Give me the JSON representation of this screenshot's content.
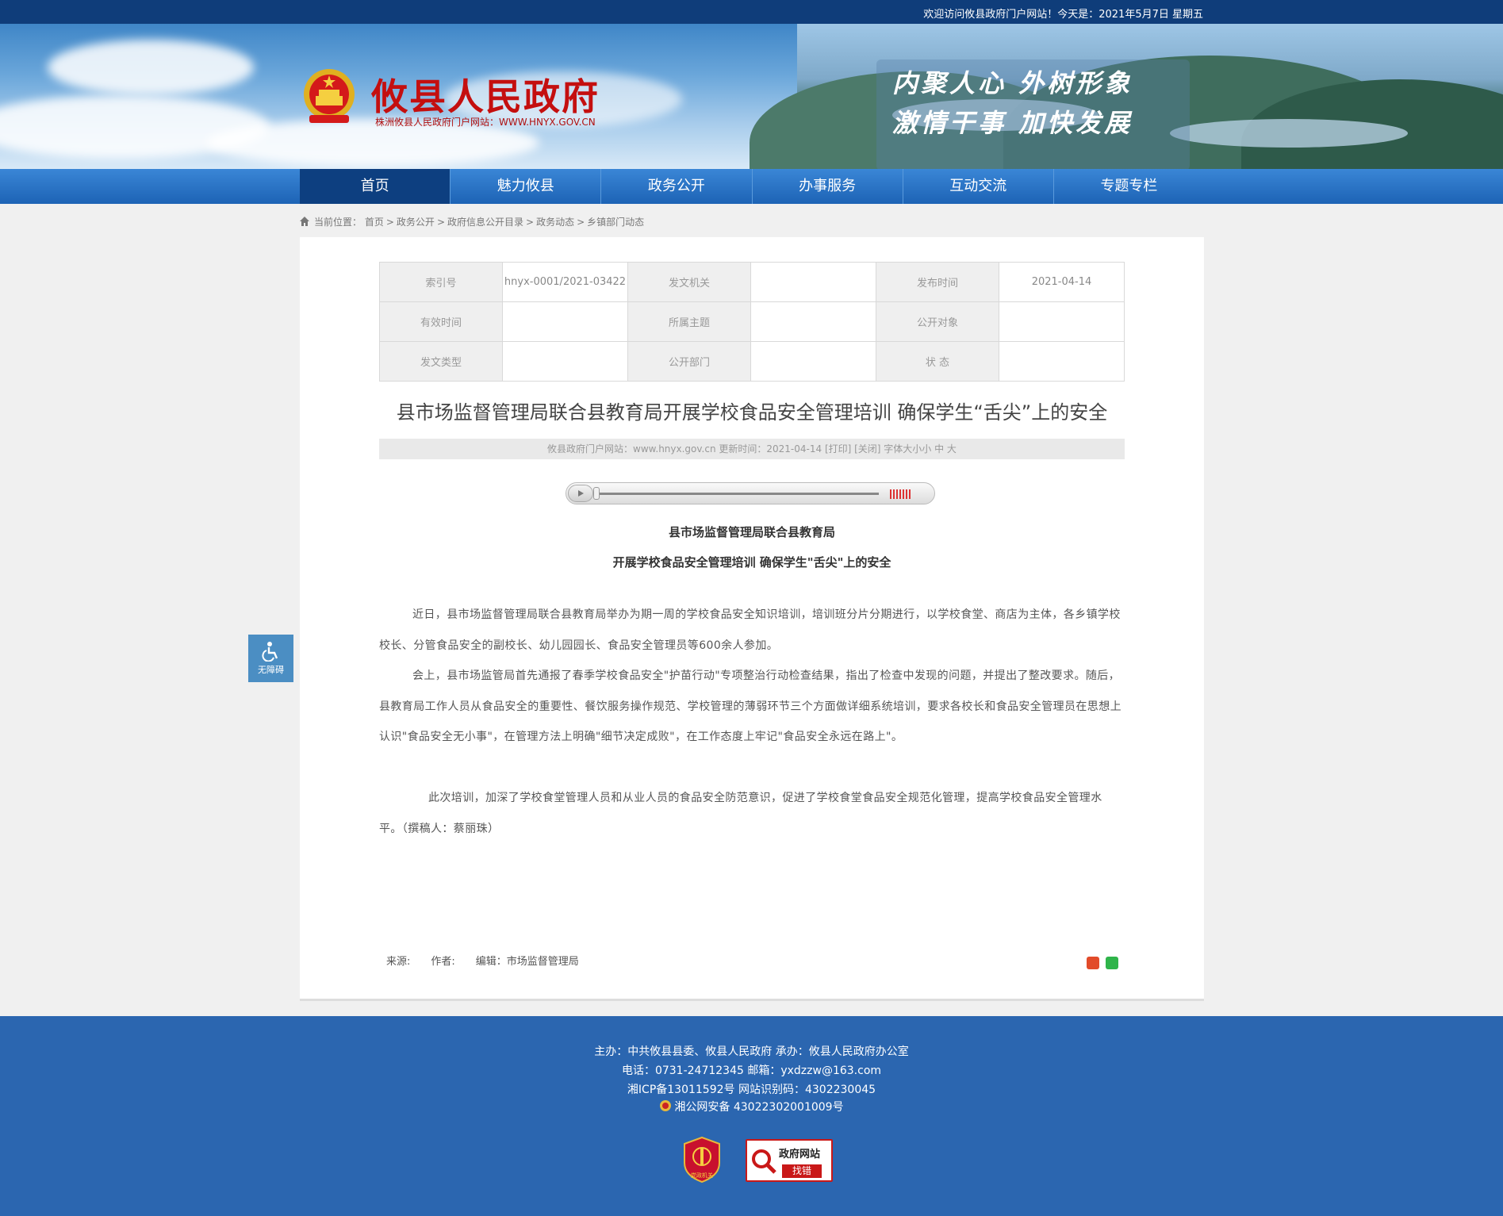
{
  "topbar": {
    "welcome": "欢迎访问攸县政府门户网站！今天是：2021年5月7日 星期五"
  },
  "header": {
    "title": "攸县人民政府",
    "subtitle": "株洲攸县人民政府门户网站：WWW.HNYX.GOV.CN",
    "slogan_line1": "内聚人心  外树形象",
    "slogan_line2": "激情干事  加快发展"
  },
  "nav": {
    "items": [
      "首页",
      "魅力攸县",
      "政务公开",
      "办事服务",
      "互动交流",
      "专题专栏"
    ],
    "active": "首页"
  },
  "breadcrumb": {
    "label": "当前位置：",
    "items": [
      "首页",
      "政务公开",
      "政府信息公开目录",
      "政务动态",
      "乡镇部门动态"
    ]
  },
  "meta": {
    "rows": [
      [
        {
          "k": "索引号",
          "v": "hnyx-0001/2021-03422"
        },
        {
          "k": "发文机关",
          "v": ""
        },
        {
          "k": "发布时间",
          "v": "2021-04-14"
        }
      ],
      [
        {
          "k": "有效时间",
          "v": ""
        },
        {
          "k": "所属主题",
          "v": ""
        },
        {
          "k": "公开对象",
          "v": ""
        }
      ],
      [
        {
          "k": "发文类型",
          "v": ""
        },
        {
          "k": "公开部门",
          "v": ""
        },
        {
          "k": "状 态",
          "v": ""
        }
      ]
    ]
  },
  "article": {
    "title": "县市场监督管理局联合县教育局开展学校食品安全管理培训 确保学生“舌尖”上的安全",
    "info": "攸县政府门户网站：www.hnyx.gov.cn    更新时间：2021-04-14  [打印]  [关闭]   字体大小小 中 大",
    "sub1": "县市场监督管理局联合县教育局",
    "sub2": "开展学校食品安全管理培训 确保学生\"舌尖\"上的安全",
    "p1": "近日，县市场监督管理局联合县教育局举办为期一周的学校食品安全知识培训，培训班分片分期进行，以学校食堂、商店为主体，各乡镇学校校长、分管食品安全的副校长、幼儿园园长、食品安全管理员等600余人参加。",
    "p2": "会上，县市场监管局首先通报了春季学校食品安全\"护苗行动\"专项整治行动检查结果，指出了检查中发现的问题，并提出了整改要求。随后，县教育局工作人员从食品安全的重要性、餐饮服务操作规范、学校管理的薄弱环节三个方面做详细系统培训，要求各校长和食品安全管理员在思想上认识\"食品安全无小事\"，在管理方法上明确\"细节决定成败\"，在工作态度上牢记\"食品安全永远在路上\"。",
    "p3": "此次培训，加深了学校食堂管理人员和从业人员的食品安全防范意识，促进了学校食堂食品安全规范化管理，提高学校食品安全管理水平。（撰稿人：蔡丽珠）",
    "source_label": "来源:",
    "author_label": "作者:",
    "editor": "编辑：市场监督管理局"
  },
  "accessibility": {
    "label": "无障碍"
  },
  "footer": {
    "line1": "主办：中共攸县县委、攸县人民政府 承办：攸县人民政府办公室",
    "line2": "电话：0731-24712345 邮箱：yxdzzw@163.com",
    "line3": "湘ICP备13011592号    网站识别码：4302230045",
    "line4": "湘公网安备 43022302001009号",
    "badge1_label": "党政机关",
    "badge2_title": "政府网站",
    "badge2_sub": "找错"
  },
  "colors": {
    "nav": "#1d63b5",
    "nav_active": "#0d3f80",
    "footer": "#2b66b0",
    "title_red": "#c40f0f"
  }
}
